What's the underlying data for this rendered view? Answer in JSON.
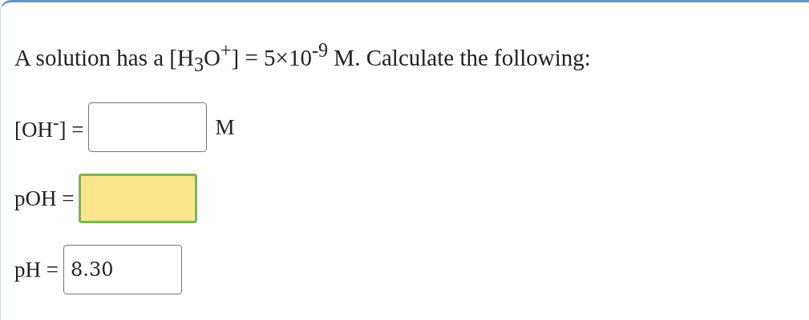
{
  "question": "A solution has a [H$_{3}$O$^{+}$] = 5×10$^{-9}$ M. Calculate the following:",
  "fields": [
    {
      "label": "[OH$^{-}$] =",
      "unit": "M",
      "focused": false
    },
    {
      "label": "pOH =",
      "focused": true
    },
    {
      "label": "pH =",
      "value": "8.30",
      "focused": false
    }
  ]
}
